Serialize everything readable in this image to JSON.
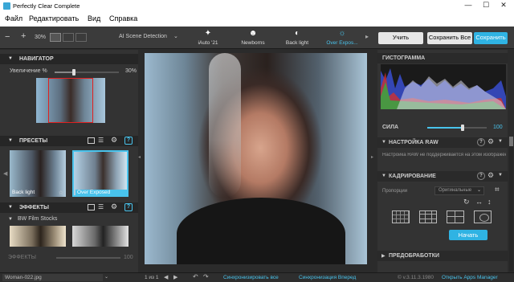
{
  "app": {
    "title": "Perfectly Clear Complete"
  },
  "menu": [
    "Файл",
    "Редактировать",
    "Вид",
    "Справка"
  ],
  "toolbar": {
    "zoom": "30%",
    "scene_detection": "AI Scene Detection",
    "presets": [
      "iAuto '21",
      "Newborns",
      "Back light",
      "Over Expos..."
    ],
    "apply": "Учить",
    "save_all": "Сохранить Все",
    "save": "Сохранить"
  },
  "navigator": {
    "title": "НАВИГАТОР",
    "zoom_label": "Увеличение %",
    "zoom_value": "30%",
    "zoom_level": 0.3
  },
  "presets_section": {
    "title": "ПРЕСЕТЫ",
    "items": [
      "Back light",
      "Over Exposed"
    ]
  },
  "effects_section": {
    "title": "ЭФФЕКТЫ",
    "category": "BW Film Stocks",
    "strength_label": "ЭФФЕКТЫ",
    "strength_value": "100"
  },
  "histogram": {
    "title": "ГИСТОГРАММА"
  },
  "strength": {
    "label": "СИЛА",
    "value": "100",
    "level": 0.6
  },
  "raw": {
    "title": "НАСТРОЙКА RAW",
    "text": "Настройка RAW не поддерживается на этом изображении"
  },
  "crop": {
    "title": "КАДРИРОВАНИЕ",
    "proportion_label": "Пропорции",
    "proportion_value": "Оригинальные",
    "apply": "Начать"
  },
  "preprocess": {
    "title": "ПРЕДОБРАБОТКИ"
  },
  "status": {
    "file": "Woman-022.jpg",
    "pages": "1 из 1",
    "sync_all": "Синхронизировать все",
    "sync_forward": "Синхронизация Вперед",
    "version": "© v.3.11.3.1980",
    "apps_manager": "Открыть Apps Manager"
  },
  "colors": {
    "accent": "#49c3ec",
    "accent_btn": "#2fb3e3",
    "panel": "#333333",
    "dark": "#262626"
  }
}
